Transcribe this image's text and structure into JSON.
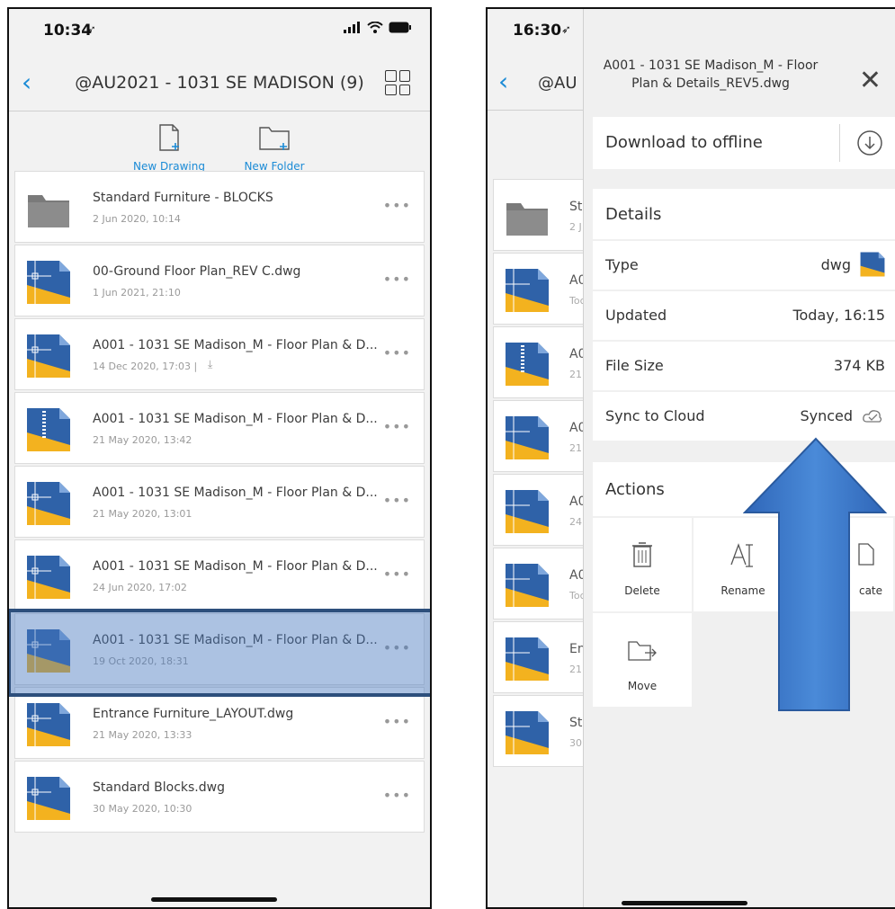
{
  "left": {
    "status_time": "10:34",
    "nav_title": "@AU2021 - 1031 SE MADISON (9)",
    "toolbar": {
      "new_drawing": "New Drawing",
      "new_folder": "New Folder"
    },
    "files": [
      {
        "name": "Standard Furniture - BLOCKS",
        "date": "2 Jun 2020, 10:14",
        "type": "folder"
      },
      {
        "name": "00-Ground Floor Plan_REV C.dwg",
        "date": "1 Jun 2021, 21:10",
        "type": "dwg"
      },
      {
        "name": "A001 - 1031 SE Madison_M - Floor Plan & D...",
        "date": "14 Dec 2020, 17:03  |",
        "type": "dwg",
        "downloaded": true
      },
      {
        "name": "A001 - 1031 SE Madison_M - Floor Plan & D...",
        "date": "21 May 2020, 13:42",
        "type": "zip"
      },
      {
        "name": "A001 - 1031 SE Madison_M - Floor Plan & D...",
        "date": "21 May 2020, 13:01",
        "type": "dwg"
      },
      {
        "name": "A001 - 1031 SE Madison_M - Floor Plan & D...",
        "date": "24 Jun 2020, 17:02",
        "type": "dwg"
      },
      {
        "name": "A001 - 1031 SE Madison_M - Floor Plan & D...",
        "date": "19 Oct 2020, 18:31",
        "type": "dwg",
        "selected": true
      },
      {
        "name": "Entrance Furniture_LAYOUT.dwg",
        "date": "21 May 2020, 13:33",
        "type": "dwg"
      },
      {
        "name": "Standard Blocks.dwg",
        "date": "30 May 2020, 10:30",
        "type": "dwg"
      }
    ]
  },
  "right": {
    "status_time": "16:30",
    "nav_title_partial": "@AU",
    "bg_rows": [
      {
        "name": "St",
        "date": "2 J"
      },
      {
        "name": "A0",
        "date": "Toc"
      },
      {
        "name": "A0",
        "date": "21"
      },
      {
        "name": "A0",
        "date": "21"
      },
      {
        "name": "A0",
        "date": "24"
      },
      {
        "name": "A0",
        "date": "Toc"
      },
      {
        "name": "En",
        "date": "21"
      },
      {
        "name": "St",
        "date": "30"
      }
    ],
    "sheet": {
      "title": "A001 - 1031 SE Madison_M - Floor Plan & Details_REV5.dwg",
      "download_label": "Download to offline",
      "details_header": "Details",
      "details": [
        {
          "label": "Type",
          "value": "dwg"
        },
        {
          "label": "Updated",
          "value": "Today, 16:15"
        },
        {
          "label": "File Size",
          "value": "374 KB"
        },
        {
          "label": "Sync to Cloud",
          "value": "Synced"
        }
      ],
      "actions_header": "Actions",
      "actions": [
        {
          "label": "Delete",
          "icon": "trash-icon"
        },
        {
          "label": "Rename",
          "icon": "rename-icon"
        },
        {
          "label": "cate",
          "icon": "duplicate-icon"
        },
        {
          "label": "Move",
          "icon": "move-folder-icon"
        }
      ]
    }
  },
  "colors": {
    "accent": "#1b8bd6",
    "dwg_blue": "#2f62a8",
    "dwg_yellow": "#f3b21f",
    "arrow": "#3a78c9",
    "selection": "#2d4f7c"
  }
}
